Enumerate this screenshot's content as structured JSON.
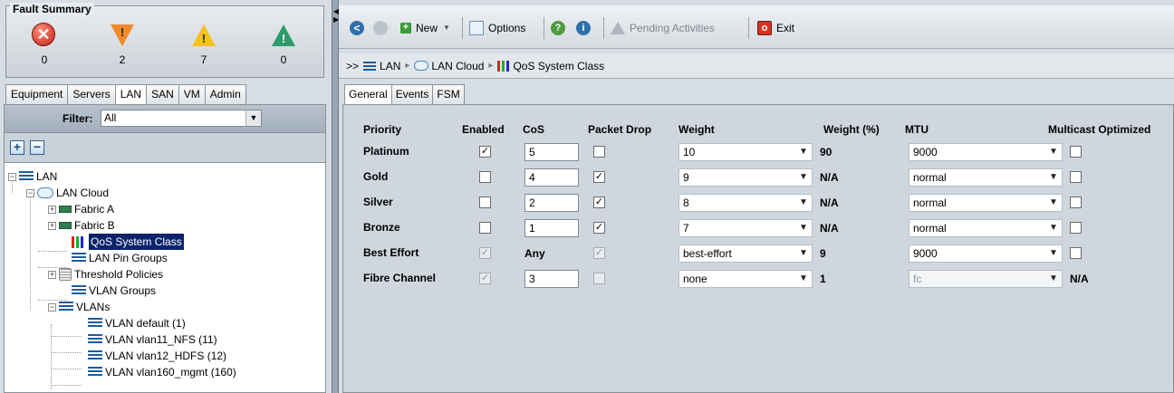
{
  "fault_summary": {
    "title": "Fault Summary",
    "items": [
      {
        "name": "critical",
        "icon": "critical-x-icon",
        "mark": "✕",
        "count": "0",
        "color": "#c1261a"
      },
      {
        "name": "major",
        "icon": "major-down-triangle-icon",
        "mark": "!",
        "count": "2",
        "color": "#f08a2a"
      },
      {
        "name": "minor",
        "icon": "minor-triangle-icon",
        "mark": "!",
        "count": "7",
        "color": "#f3c21b"
      },
      {
        "name": "warning",
        "icon": "warning-triangle-icon",
        "mark": "!",
        "count": "0",
        "color": "#2f9a6a"
      }
    ]
  },
  "nav_tabs": [
    "Equipment",
    "Servers",
    "LAN",
    "SAN",
    "VM",
    "Admin"
  ],
  "nav_tabs_active": "LAN",
  "filter": {
    "label": "Filter:",
    "value": "All"
  },
  "tree": {
    "root": "LAN",
    "lan_cloud": "LAN Cloud",
    "fabric_a": "Fabric A",
    "fabric_b": "Fabric B",
    "qos_system_class": "QoS System Class",
    "lan_pin_groups": "LAN Pin Groups",
    "threshold_policies": "Threshold Policies",
    "vlan_groups": "VLAN Groups",
    "vlans": "VLANs",
    "vlan_items": [
      "VLAN default (1)",
      "VLAN vlan11_NFS (11)",
      "VLAN vlan12_HDFS (12)",
      "VLAN vlan160_mgmt (160)"
    ]
  },
  "toolbar": {
    "new": "New",
    "options": "Options",
    "pending": "Pending Activities",
    "exit": "Exit"
  },
  "breadcrumb": {
    "prefix": ">>",
    "items": [
      "LAN",
      "LAN Cloud",
      "QoS System Class"
    ]
  },
  "content_tabs": [
    "General",
    "Events",
    "FSM"
  ],
  "content_tabs_active": "General",
  "qos": {
    "headers": {
      "priority": "Priority",
      "enabled": "Enabled",
      "cos": "CoS",
      "packet_drop": "Packet Drop",
      "weight": "Weight",
      "weight_pct": "Weight (%)",
      "mtu": "MTU",
      "multicast": "Multicast Optimized"
    },
    "rows": [
      {
        "priority": "Platinum",
        "enabled": true,
        "enabled_disabled": false,
        "cos": "5",
        "cos_editable": true,
        "drop": false,
        "drop_disabled": false,
        "weight": "10",
        "weight_pct": "90",
        "mtu": "9000",
        "mtu_disabled": false,
        "multicast": false,
        "multicast_shown": true
      },
      {
        "priority": "Gold",
        "enabled": false,
        "enabled_disabled": false,
        "cos": "4",
        "cos_editable": true,
        "drop": true,
        "drop_disabled": false,
        "weight": "9",
        "weight_pct": "N/A",
        "mtu": "normal",
        "mtu_disabled": false,
        "multicast": false,
        "multicast_shown": true
      },
      {
        "priority": "Silver",
        "enabled": false,
        "enabled_disabled": false,
        "cos": "2",
        "cos_editable": true,
        "drop": true,
        "drop_disabled": false,
        "weight": "8",
        "weight_pct": "N/A",
        "mtu": "normal",
        "mtu_disabled": false,
        "multicast": false,
        "multicast_shown": true
      },
      {
        "priority": "Bronze",
        "enabled": false,
        "enabled_disabled": false,
        "cos": "1",
        "cos_editable": true,
        "drop": true,
        "drop_disabled": false,
        "weight": "7",
        "weight_pct": "N/A",
        "mtu": "normal",
        "mtu_disabled": false,
        "multicast": false,
        "multicast_shown": true
      },
      {
        "priority": "Best Effort",
        "enabled": true,
        "enabled_disabled": true,
        "cos": "Any",
        "cos_editable": false,
        "drop": true,
        "drop_disabled": true,
        "weight": "best-effort",
        "weight_pct": "9",
        "mtu": "9000",
        "mtu_disabled": false,
        "multicast": false,
        "multicast_shown": true
      },
      {
        "priority": "Fibre Channel",
        "enabled": true,
        "enabled_disabled": true,
        "cos": "3",
        "cos_editable": true,
        "drop": false,
        "drop_disabled": true,
        "weight": "none",
        "weight_pct": "1",
        "mtu": "fc",
        "mtu_disabled": true,
        "multicast": "N/A",
        "multicast_shown": false
      }
    ]
  }
}
